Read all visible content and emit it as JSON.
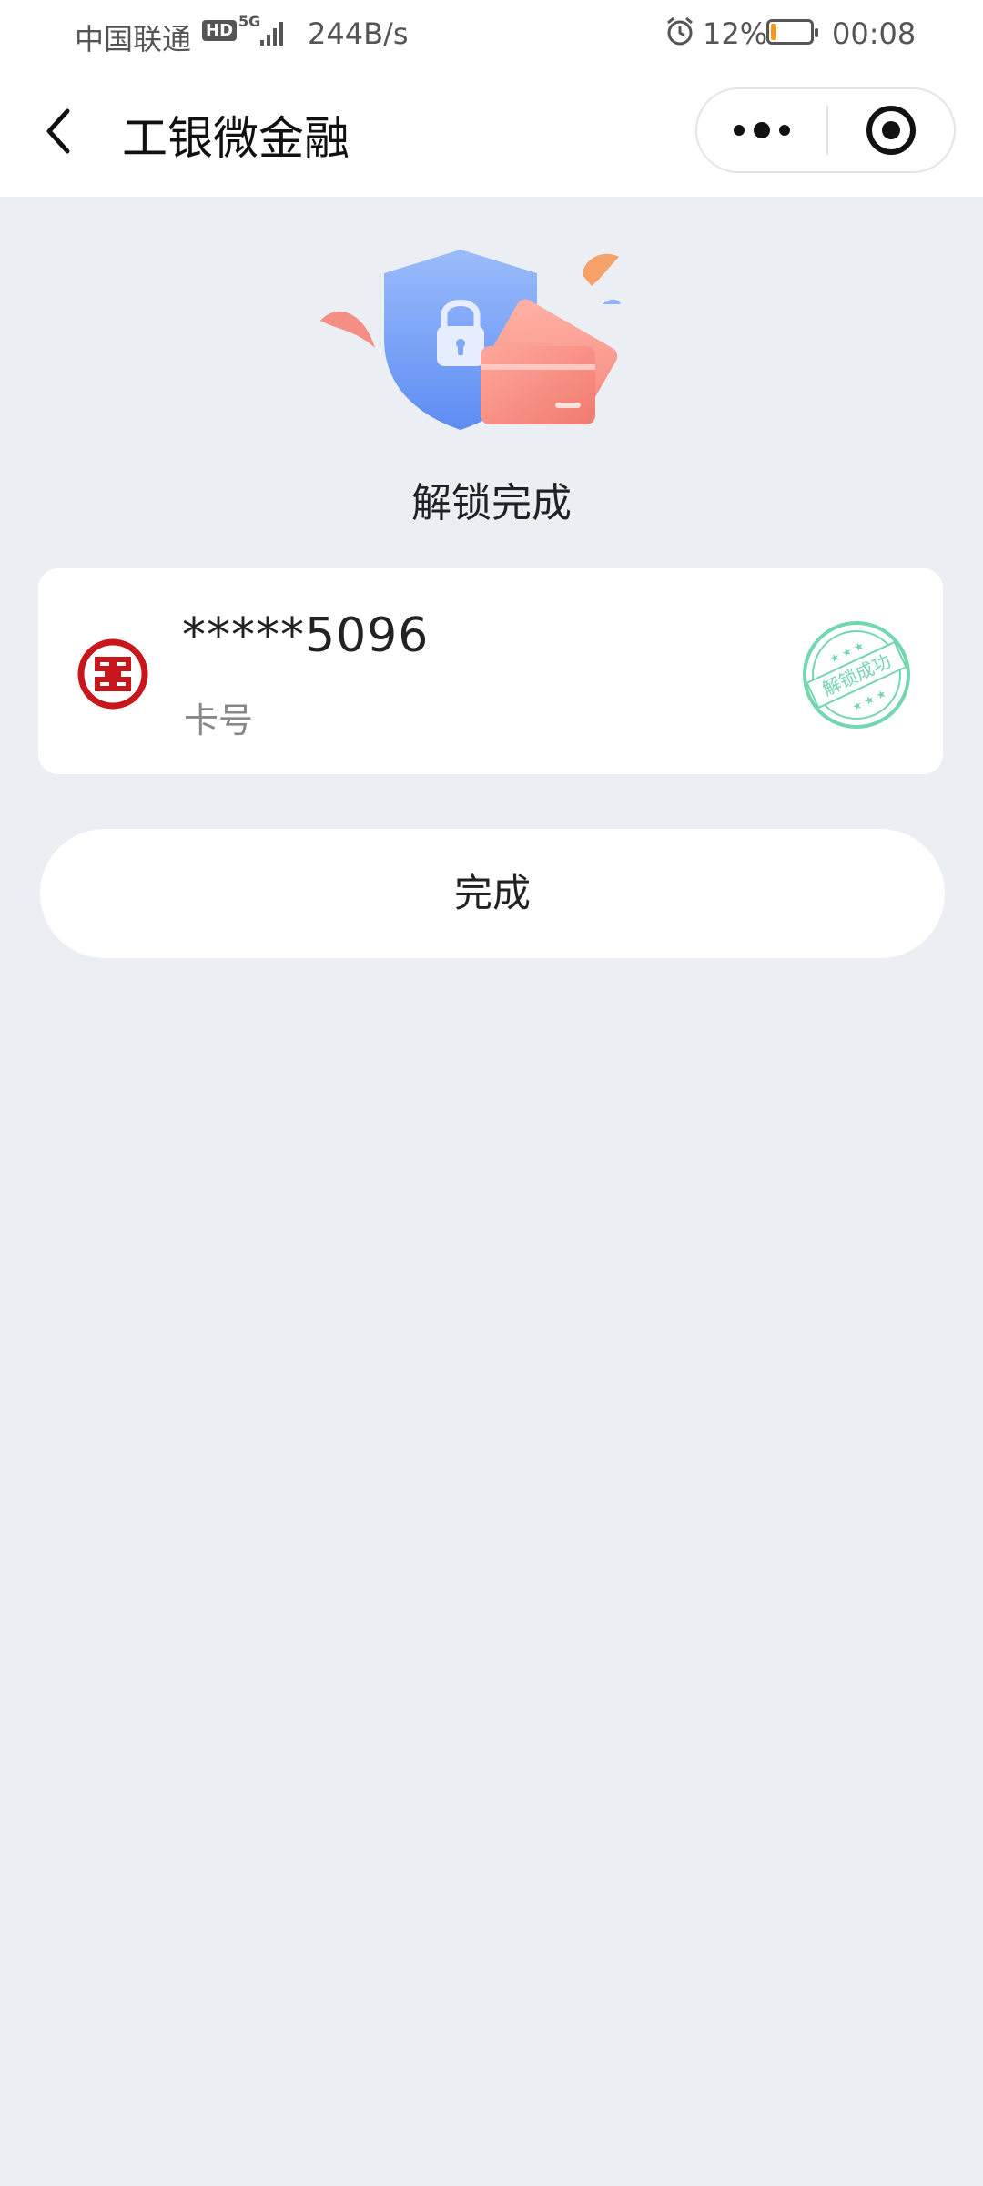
{
  "status_bar": {
    "carrier": "中国联通",
    "hd": "HD",
    "network": "5G",
    "speed": "244B/s",
    "battery": "12%",
    "battery_level": 0.12,
    "time": "00:08"
  },
  "nav": {
    "title": "工银微金融"
  },
  "result": {
    "title": "解锁完成"
  },
  "card": {
    "number": "*****5096",
    "label": "卡号",
    "stamp_text": "解锁成功"
  },
  "buttons": {
    "done": "完成"
  },
  "colors": {
    "page_background": "#ebeff4",
    "bank_red": "#c8161d",
    "stamp_green": "#5ccfa0",
    "battery_orange": "#f39a1c",
    "shield_blue": "#7ea7f7",
    "card_coral": "#f38a80"
  },
  "icons": {
    "back": "chevron-left-icon",
    "more": "more-dots-icon",
    "close_target": "target-circle-icon",
    "alarm": "alarm-icon",
    "bank": "icbc-logo"
  }
}
